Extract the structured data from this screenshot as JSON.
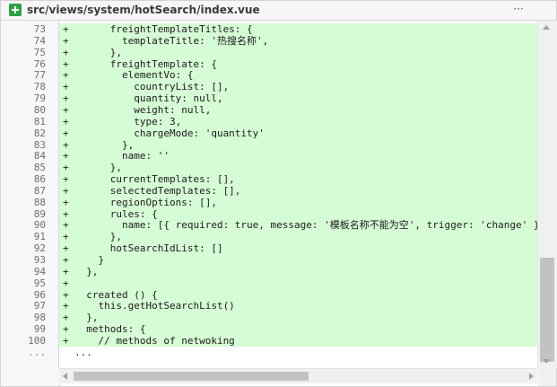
{
  "file_header": {
    "status_icon": "plus-icon",
    "path": "src/views/system/hotSearch/index.vue",
    "more_label": "···"
  },
  "colors": {
    "added_line_bg": "#d6fcd6",
    "add_badge": "#2ea043"
  },
  "diff_lines": [
    {
      "num": "73",
      "marker": "+",
      "code": "      freightTemplateTitles: {"
    },
    {
      "num": "74",
      "marker": "+",
      "code": "        templateTitle: '热搜名称',"
    },
    {
      "num": "75",
      "marker": "+",
      "code": "      },"
    },
    {
      "num": "76",
      "marker": "+",
      "code": "      freightTemplate: {"
    },
    {
      "num": "77",
      "marker": "+",
      "code": "        elementVo: {"
    },
    {
      "num": "78",
      "marker": "+",
      "code": "          countryList: [],"
    },
    {
      "num": "79",
      "marker": "+",
      "code": "          quantity: null,"
    },
    {
      "num": "80",
      "marker": "+",
      "code": "          weight: null,"
    },
    {
      "num": "81",
      "marker": "+",
      "code": "          type: 3,"
    },
    {
      "num": "82",
      "marker": "+",
      "code": "          chargeMode: 'quantity'"
    },
    {
      "num": "83",
      "marker": "+",
      "code": "        },"
    },
    {
      "num": "84",
      "marker": "+",
      "code": "        name: ''"
    },
    {
      "num": "85",
      "marker": "+",
      "code": "      },"
    },
    {
      "num": "86",
      "marker": "+",
      "code": "      currentTemplates: [],"
    },
    {
      "num": "87",
      "marker": "+",
      "code": "      selectedTemplates: [],"
    },
    {
      "num": "88",
      "marker": "+",
      "code": "      regionOptions: [],"
    },
    {
      "num": "89",
      "marker": "+",
      "code": "      rules: {"
    },
    {
      "num": "90",
      "marker": "+",
      "code": "        name: [{ required: true, message: '模板名称不能为空', trigger: 'change' }]"
    },
    {
      "num": "91",
      "marker": "+",
      "code": "      },"
    },
    {
      "num": "92",
      "marker": "+",
      "code": "      hotSearchIdList: []"
    },
    {
      "num": "93",
      "marker": "+",
      "code": "    }"
    },
    {
      "num": "94",
      "marker": "+",
      "code": "  },"
    },
    {
      "num": "95",
      "marker": "+",
      "code": ""
    },
    {
      "num": "96",
      "marker": "+",
      "code": "  created () {"
    },
    {
      "num": "97",
      "marker": "+",
      "code": "    this.getHotSearchList()"
    },
    {
      "num": "98",
      "marker": "+",
      "code": "  },"
    },
    {
      "num": "99",
      "marker": "+",
      "code": "  methods: {"
    },
    {
      "num": "100",
      "marker": "+",
      "code": "    // methods of netwoking"
    }
  ],
  "collapsed_row": {
    "num": "...",
    "code": "..."
  }
}
